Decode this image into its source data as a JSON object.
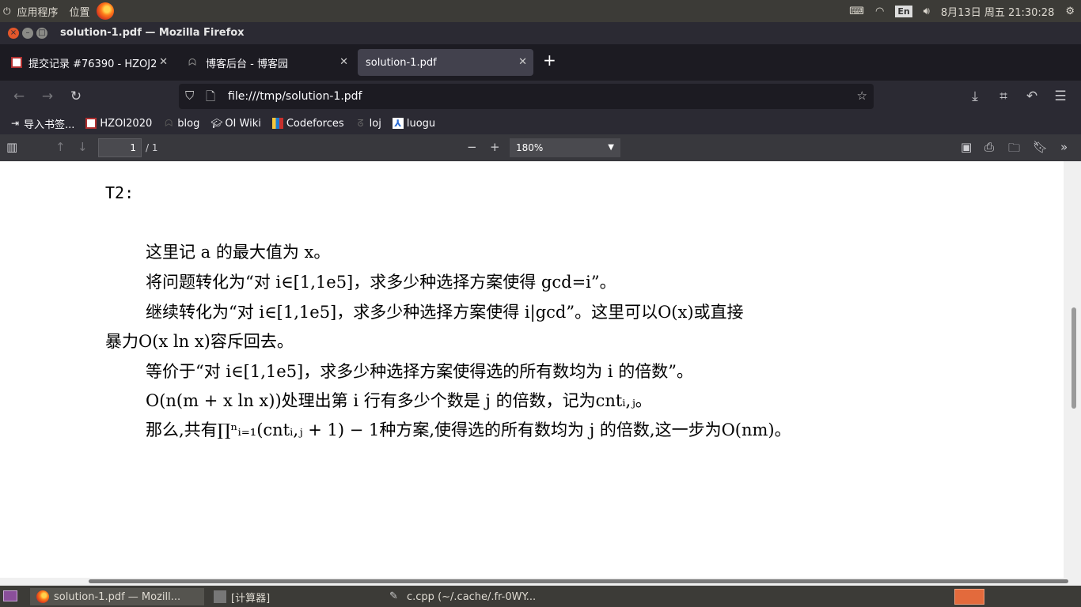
{
  "top_panel": {
    "apps_label": "应用程序",
    "places_label": "位置",
    "lang": "En",
    "datetime": "8月13日 周五 21:30:28"
  },
  "window": {
    "title": "solution-1.pdf — Mozilla Firefox"
  },
  "tabs": [
    {
      "label": "提交记录 #76390 - HZOJ2",
      "favicon": "hzoi-icon"
    },
    {
      "label": "博客后台 - 博客园",
      "favicon": "cnblogs-icon"
    },
    {
      "label": "solution-1.pdf",
      "active": true
    }
  ],
  "navbar": {
    "url": "file:///tmp/solution-1.pdf"
  },
  "bookmarks": [
    {
      "label": "导入书签...",
      "icon": "import-icon"
    },
    {
      "label": "HZOI2020",
      "icon": "hzoi-icon"
    },
    {
      "label": "blog",
      "icon": "blog-icon"
    },
    {
      "label": "OI Wiki",
      "icon": "oiwiki-icon"
    },
    {
      "label": "Codeforces",
      "icon": "codeforces-icon"
    },
    {
      "label": "loj",
      "icon": "loj-icon"
    },
    {
      "label": "luogu",
      "icon": "luogu-icon"
    }
  ],
  "pdf_toolbar": {
    "page_number": "1",
    "page_total": "/ 1",
    "zoom": "180%"
  },
  "document": {
    "heading": "T2:",
    "lines": [
      "这里记 a 的最大值为 x。",
      "将问题转化为“对 i∈[1,1e5]，求多少种选择方案使得 gcd=i”。",
      "继续转化为“对 i∈[1,1e5]，求多少种选择方案使得 i|gcd”。这里可以O(x)或直接",
      "暴力O(x ln x)容斥回去。",
      "等价于“对 i∈[1,1e5]，求多少种选择方案使得选的所有数均为 i 的倍数”。",
      "O(n(m + x ln x))处理出第 i 行有多少个数是 j 的倍数，记为cntᵢ,ⱼ。",
      "那么,共有∏ⁿᵢ₌₁(cntᵢ,ⱼ + 1) − 1种方案,使得选的所有数均为 j 的倍数,这一步为O(nm)。"
    ]
  },
  "taskbar": [
    {
      "label": "solution-1.pdf — Mozill...",
      "icon": "firefox-icon",
      "active": true
    },
    {
      "label": "[计算器]",
      "icon": "calculator-icon"
    },
    {
      "label": "c.cpp (~/.cache/.fr-0WY...",
      "icon": "text-editor-icon"
    }
  ]
}
